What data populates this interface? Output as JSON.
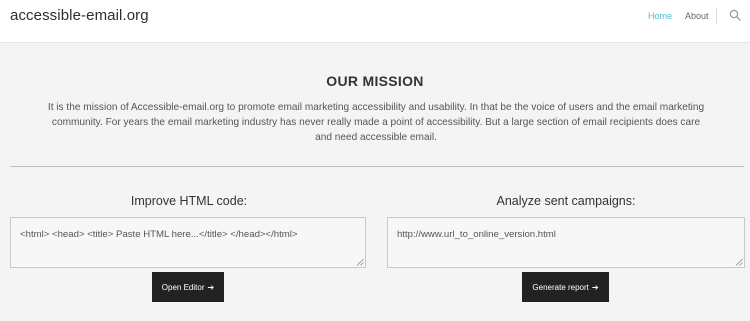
{
  "header": {
    "logo": "accessible-email.org",
    "nav": {
      "home": "Home",
      "about": "About"
    }
  },
  "mission": {
    "title": "OUR MISSION",
    "line1": "It is the mission of Accessible-email.org to promote email marketing accessibility and usability. In that be the voice of users and the email marketing",
    "line2": "community. For years the email marketing industry has never really made a point of accessibility. But a large section of email recipients does care",
    "line3": "and need accessible email."
  },
  "improve": {
    "title": "Improve HTML code:",
    "placeholder": "<html> <head> <title> Paste HTML here...</title> </head></html>",
    "button": "Open Editor"
  },
  "analyze": {
    "title": "Analyze sent campaigns:",
    "placeholder": "http://www.url_to_online_version.html",
    "button": "Generate report"
  },
  "colors": {
    "accent": "#53b8cf",
    "button_bg": "#222222",
    "page_bg": "#f4f4f4"
  },
  "icons": {
    "search": "search-icon",
    "arrow": "arrow-right-icon"
  }
}
